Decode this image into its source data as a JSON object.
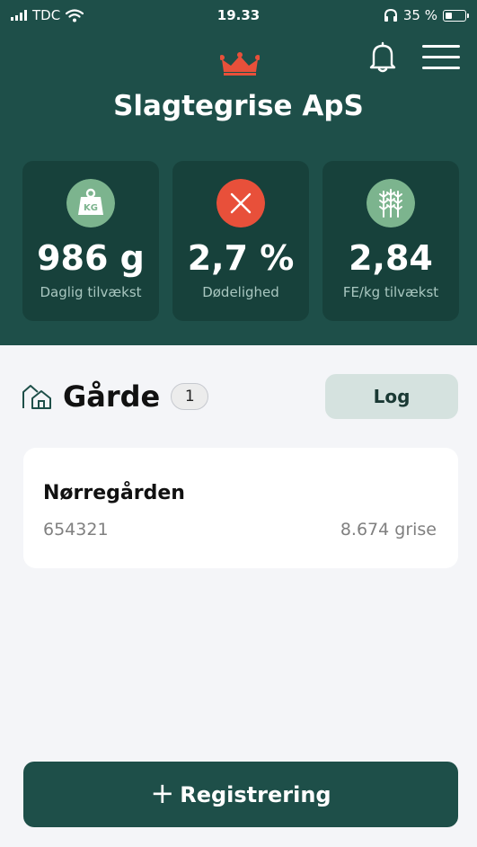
{
  "status_bar": {
    "carrier": "TDC",
    "time": "19.33",
    "battery_percent": "35 %",
    "battery_level": 0.35
  },
  "header": {
    "company_name": "Slagtegrise ApS",
    "logo_icon": "crown-icon",
    "notification_icon": "bell-icon",
    "menu_icon": "hamburger-menu-icon"
  },
  "stats": [
    {
      "icon": "weight-kg-icon",
      "icon_text": "KG",
      "value": "986 g",
      "label": "Daglig tilvækst",
      "icon_color": "#7cb48e"
    },
    {
      "icon": "close-x-icon",
      "value": "2,7 %",
      "label": "Dødelighed",
      "icon_color": "#e8503a"
    },
    {
      "icon": "wheat-icon",
      "value": "2,84",
      "label": "FE/kg tilvækst",
      "icon_color": "#7cb48e"
    }
  ],
  "farms_section": {
    "title": "Gårde",
    "count": "1",
    "log_label": "Log",
    "farms": [
      {
        "name": "Nørregården",
        "id": "654321",
        "pigs": "8.674 grise"
      }
    ]
  },
  "register_button": {
    "plus": "+",
    "label": "Registrering"
  },
  "colors": {
    "primary": "#1e4f49",
    "card_dark": "#17413b",
    "accent_red": "#e8503a",
    "accent_green": "#7cb48e",
    "background": "#f4f5f8"
  }
}
